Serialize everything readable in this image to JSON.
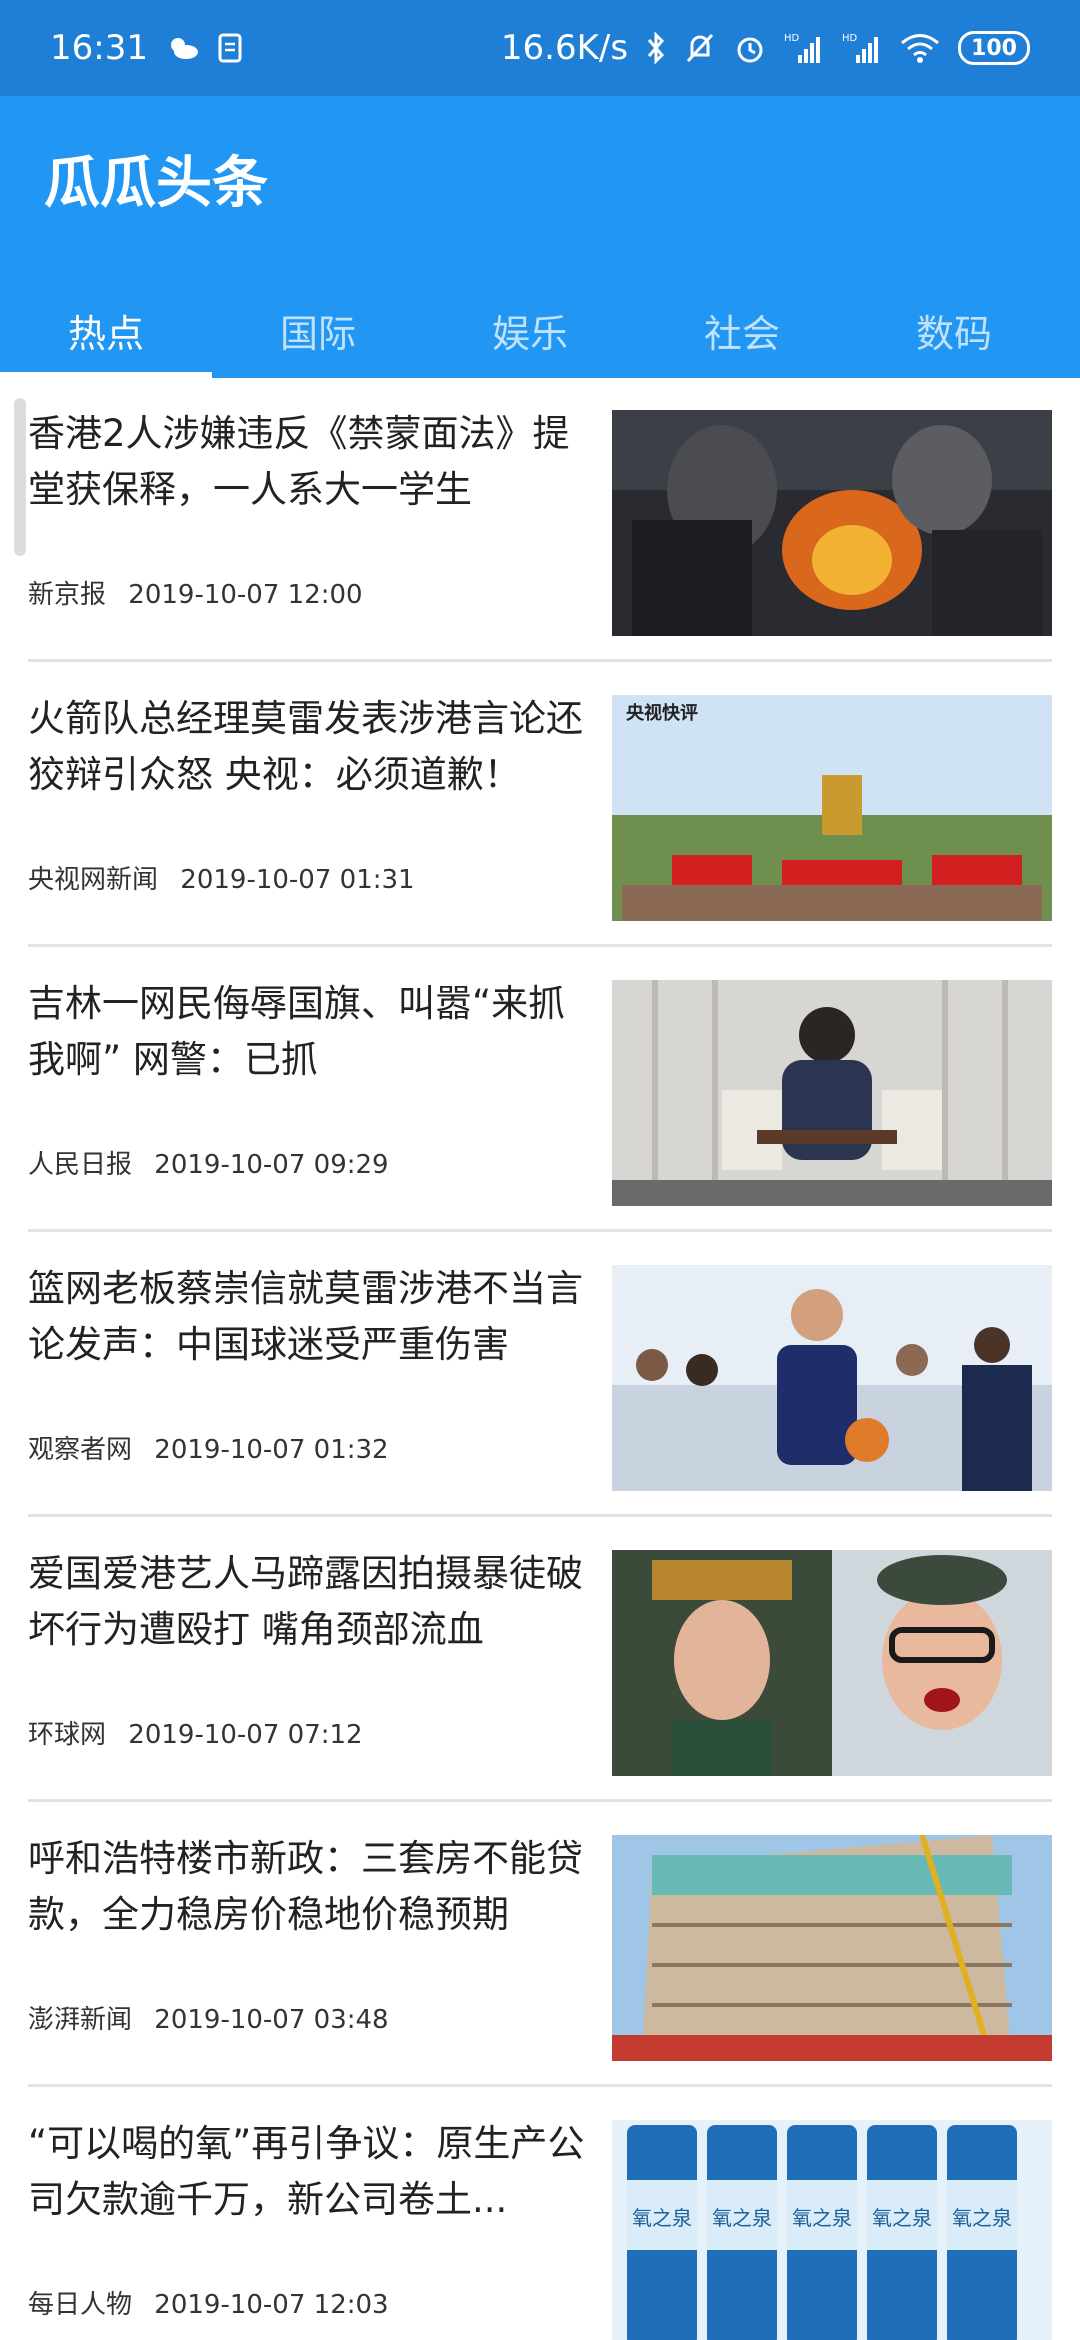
{
  "status_bar": {
    "time": "16:31",
    "net_speed": "16.6K/s",
    "hd1": "HD",
    "hd2": "HD",
    "battery": "100"
  },
  "app": {
    "title": "瓜瓜头条"
  },
  "tabs": [
    {
      "label": "热点",
      "active": true
    },
    {
      "label": "国际",
      "active": false
    },
    {
      "label": "娱乐",
      "active": false
    },
    {
      "label": "社会",
      "active": false
    },
    {
      "label": "数码",
      "active": false
    }
  ],
  "news": [
    {
      "title": "香港2人涉嫌违反《禁蒙面法》提堂获保释，一人系大一学生",
      "source": "新京报",
      "time": "2019-10-07 12:00"
    },
    {
      "title": "火箭队总经理莫雷发表涉港言论还狡辩引众怒 央视：必须道歉！",
      "source": "央视网新闻",
      "time": "2019-10-07 01:31",
      "image_caption": "央视快评"
    },
    {
      "title": "吉林一网民侮辱国旗、叫嚣“来抓我啊” 网警：已抓",
      "source": "人民日报",
      "time": "2019-10-07 09:29"
    },
    {
      "title": "篮网老板蔡崇信就莫雷涉港不当言论发声：中国球迷受严重伤害",
      "source": "观察者网",
      "time": "2019-10-07 01:32"
    },
    {
      "title": "爱国爱港艺人马蹄露因拍摄暴徒破坏行为遭殴打 嘴角颈部流血",
      "source": "环球网",
      "time": "2019-10-07 07:12"
    },
    {
      "title": "呼和浩特楼市新政：三套房不能贷款，全力稳房价稳地价稳预期",
      "source": "澎湃新闻",
      "time": "2019-10-07 03:48"
    },
    {
      "title": "“可以喝的氧”再引争议：原生产公司欠款逾千万，新公司卷土...",
      "source": "每日人物",
      "time": "2019-10-07 12:03",
      "image_caption": "氧之泉"
    }
  ],
  "colors": {
    "status_bar": "#1f7fd6",
    "app_bar": "#2196f3",
    "divider": "#e2e2e2",
    "text": "#222222"
  }
}
